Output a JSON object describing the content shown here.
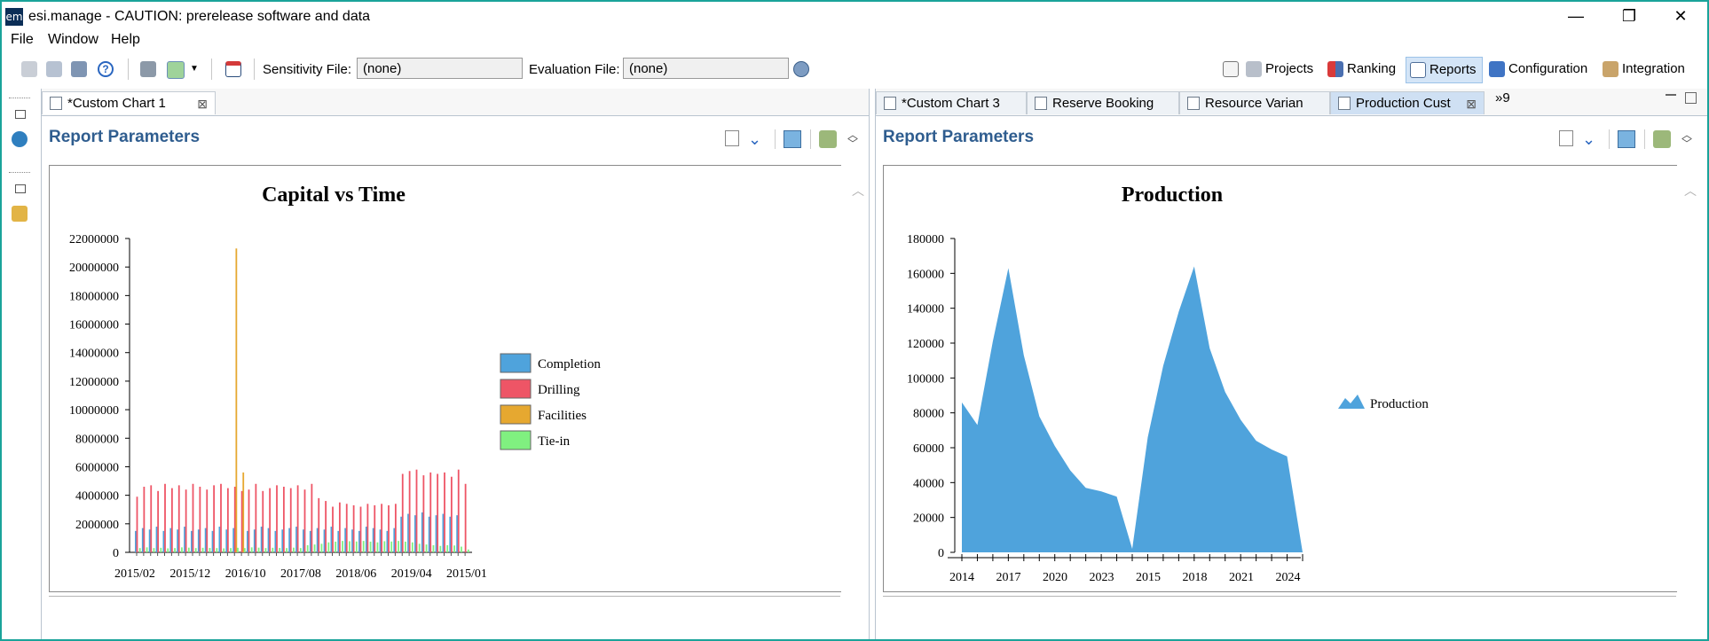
{
  "window": {
    "app_icon_label": "em",
    "title": "esi.manage - CAUTION: prerelease software and data",
    "minimize": "—",
    "restore": "❐",
    "close": "✕",
    "accent": "#1aa39a"
  },
  "menu": [
    "File",
    "Window",
    "Help"
  ],
  "toolbar": {
    "sensitivity_label": "Sensitivity File:",
    "sensitivity_value": "(none)",
    "evaluation_label": "Evaluation File:",
    "evaluation_value": "(none)",
    "perspectives": [
      {
        "label": "Projects",
        "icon": "projects-icon"
      },
      {
        "label": "Ranking",
        "icon": "ranking-icon"
      },
      {
        "label": "Reports",
        "icon": "reports-icon",
        "active": true
      },
      {
        "label": "Configuration",
        "icon": "configuration-icon"
      },
      {
        "label": "Integration",
        "icon": "integration-icon"
      }
    ]
  },
  "left_pane": {
    "tab_label": "*Custom Chart 1",
    "report_parameters": "Report Parameters"
  },
  "right_pane": {
    "tabs": [
      "*Custom Chart 3",
      "Reserve Booking",
      "Resource Varian",
      "Production Cust"
    ],
    "overflow_label": "»9",
    "report_parameters": "Report Parameters"
  },
  "chart_data": [
    {
      "type": "bar",
      "title": "Capital vs Time",
      "xlabel": "",
      "ylabel": "",
      "ylim": [
        0,
        22000000
      ],
      "y_ticks": [
        0,
        2000000,
        4000000,
        6000000,
        8000000,
        10000000,
        12000000,
        14000000,
        16000000,
        18000000,
        20000000,
        22000000
      ],
      "y_tick_labels": [
        "0",
        "2000000",
        "4000000",
        "6000000",
        "8000000",
        "10000000",
        "12000000",
        "14000000",
        "16000000",
        "18000000",
        "20000000",
        "22000000"
      ],
      "x_tick_labels": [
        "2015/02",
        "2015/12",
        "2016/10",
        "2017/08",
        "2018/06",
        "2019/04",
        "2015/01"
      ],
      "legend": "right",
      "series": [
        {
          "name": "Completion",
          "color": "#4fa3dc",
          "values": [
            1500000,
            1700000,
            1600000,
            1800000,
            1500000,
            1700000,
            1600000,
            1800000,
            1500000,
            1600000,
            1700000,
            1500000,
            1800000,
            1600000,
            1700000,
            0,
            1500000,
            1600000,
            1800000,
            1700000,
            1500000,
            1600000,
            1700000,
            1800000,
            1600000,
            1500000,
            1700000,
            1600000,
            1800000,
            1500000,
            1700000,
            1600000,
            1500000,
            1800000,
            1700000,
            1600000,
            1500000,
            1700000,
            2500000,
            2700000,
            2600000,
            2800000,
            2500000,
            2600000,
            2700000,
            2500000,
            2600000,
            0
          ]
        },
        {
          "name": "Drilling",
          "color": "#ee5566",
          "values": [
            3900000,
            4600000,
            4700000,
            4300000,
            4800000,
            4500000,
            4700000,
            4400000,
            4800000,
            4600000,
            4400000,
            4700000,
            4800000,
            4500000,
            4600000,
            4300000,
            4400000,
            4800000,
            4300000,
            4500000,
            4700000,
            4600000,
            4500000,
            4700000,
            4400000,
            4800000,
            3800000,
            3600000,
            3200000,
            3500000,
            3400000,
            3300000,
            3200000,
            3400000,
            3300000,
            3400000,
            3300000,
            3400000,
            5500000,
            5700000,
            5800000,
            5400000,
            5600000,
            5500000,
            5600000,
            5300000,
            5800000,
            4800000
          ]
        },
        {
          "name": "Facilities",
          "color": "#e6a830",
          "values": [
            0,
            0,
            0,
            0,
            0,
            0,
            0,
            0,
            0,
            0,
            0,
            0,
            0,
            0,
            21300000,
            5600000,
            0,
            0,
            0,
            0,
            0,
            0,
            0,
            0,
            0,
            0,
            0,
            0,
            0,
            0,
            0,
            0,
            0,
            0,
            0,
            0,
            0,
            0,
            0,
            0,
            0,
            0,
            0,
            0,
            0,
            0,
            0,
            0
          ]
        },
        {
          "name": "Tie-in",
          "color": "#80f080",
          "values": [
            300000,
            350000,
            300000,
            320000,
            280000,
            300000,
            350000,
            330000,
            300000,
            320000,
            310000,
            300000,
            280000,
            300000,
            320000,
            300000,
            350000,
            330000,
            300000,
            320000,
            310000,
            300000,
            330000,
            300000,
            500000,
            550000,
            600000,
            700000,
            750000,
            800000,
            780000,
            760000,
            800000,
            750000,
            700000,
            780000,
            760000,
            800000,
            750000,
            700000,
            600000,
            550000,
            500000,
            450000,
            500000,
            480000,
            400000,
            200000
          ]
        }
      ]
    },
    {
      "type": "area",
      "title": "Production",
      "xlabel": "",
      "ylabel": "",
      "ylim": [
        0,
        180000
      ],
      "y_ticks": [
        0,
        20000,
        40000,
        60000,
        80000,
        100000,
        120000,
        140000,
        160000,
        180000
      ],
      "y_tick_labels": [
        "0",
        "20000",
        "40000",
        "60000",
        "80000",
        "100000",
        "120000",
        "140000",
        "160000",
        "180000"
      ],
      "x_tick_labels": [
        "2014",
        "2017",
        "2020",
        "2023",
        "2015",
        "2018",
        "2021",
        "2024"
      ],
      "legend": "right",
      "series": [
        {
          "name": "Production",
          "color": "#4fa3dc",
          "values": [
            86000,
            73000,
            121000,
            163000,
            113000,
            78000,
            61000,
            47000,
            37000,
            35000,
            32000,
            2000,
            66000,
            107000,
            138000,
            164000,
            117000,
            92000,
            76000,
            64000,
            59000,
            55000,
            0
          ]
        }
      ]
    }
  ]
}
